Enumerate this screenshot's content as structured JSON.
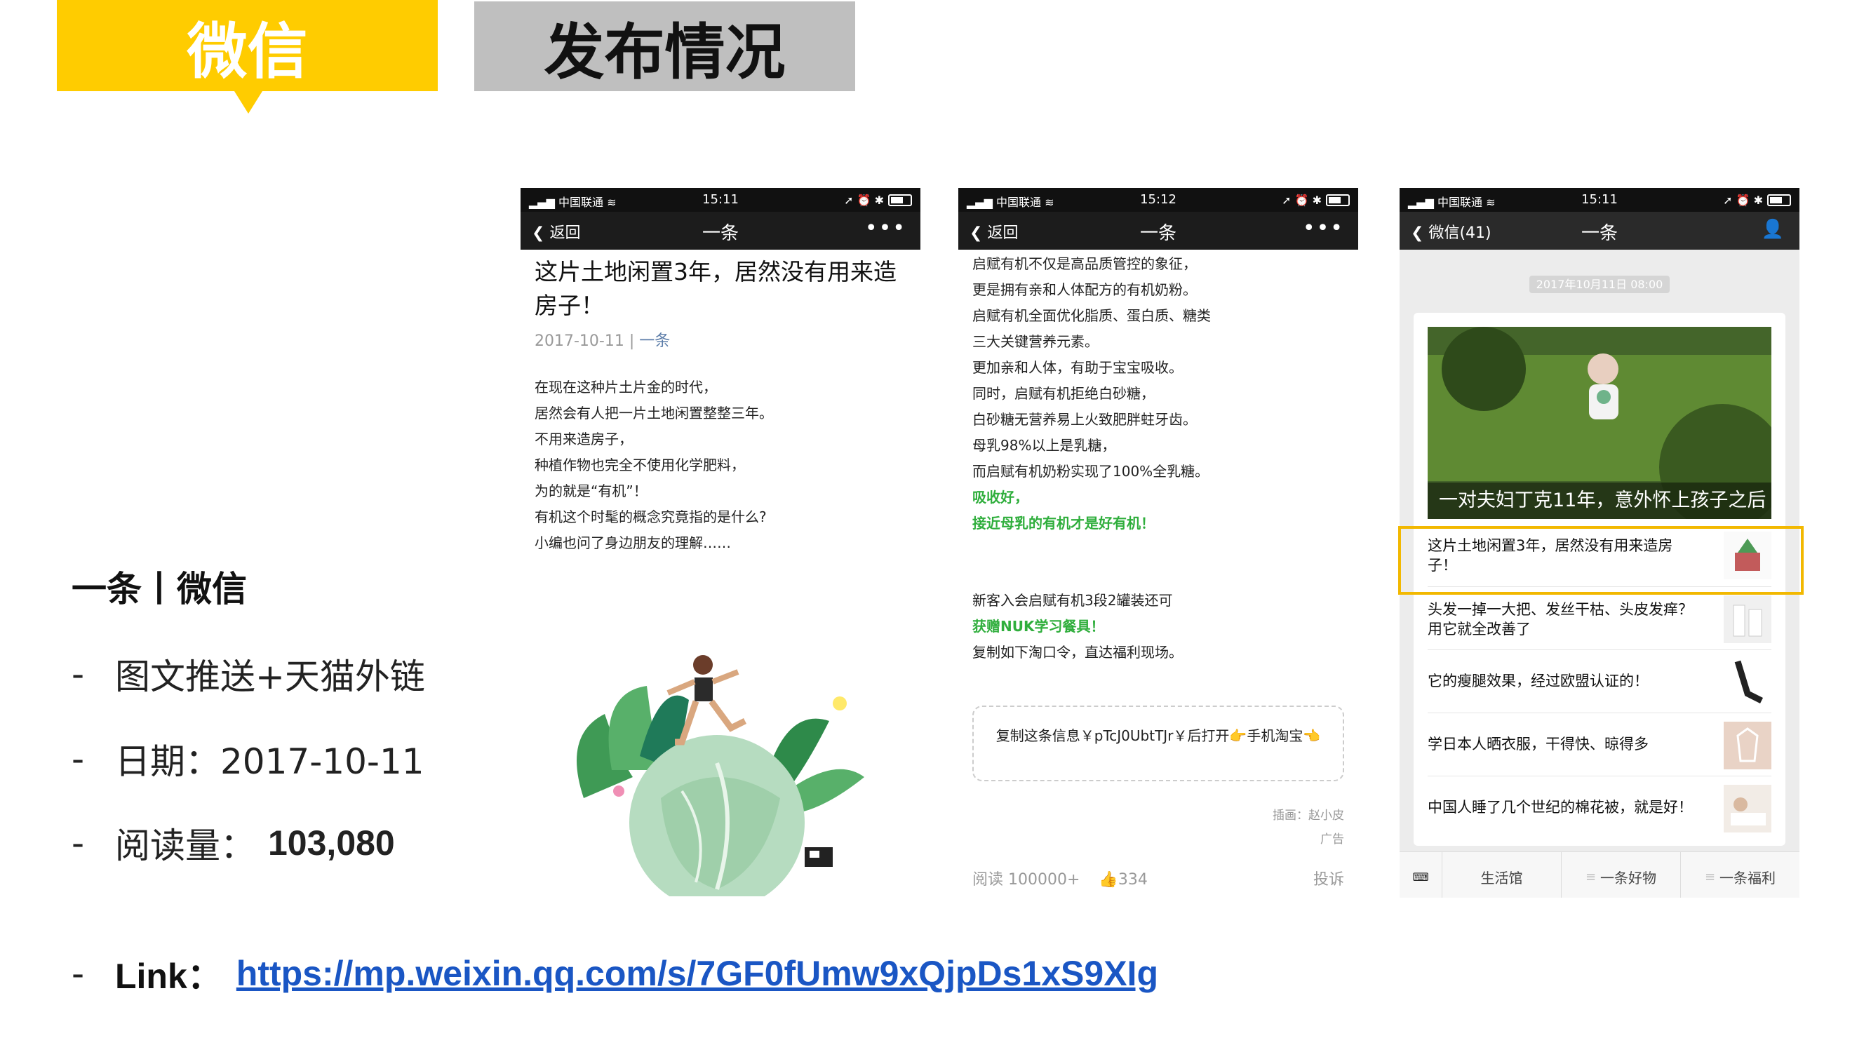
{
  "header": {
    "tag_primary": "微信",
    "tag_secondary": "发布情况"
  },
  "info": {
    "title": "一条丨微信",
    "items": [
      {
        "label": "图文推送+天猫外链",
        "value": ""
      },
      {
        "label": "日期：2017-10-11",
        "value": ""
      },
      {
        "label": "阅读量：",
        "value": "103,080"
      }
    ],
    "link_label": "Link：",
    "link_url": "https://mp.weixin.qq.com/s/7GF0fUmw9xQjpDs1xS9XIg"
  },
  "phone1": {
    "carrier": "中国联通",
    "time": "15:11",
    "back": "返回",
    "nav_title": "一条",
    "article_title": "这片土地闲置3年，居然没有用来造房子！",
    "date": "2017-10-11",
    "source": "一条",
    "lines": [
      "在现在这种片土片金的时代，",
      "居然会有人把一片土地闲置整整三年。",
      "不用来造房子，",
      "种植作物也完全不使用化学肥料，",
      "为的就是“有机”！",
      "有机这个时髦的概念究竟指的是什么?",
      "小编也问了身边朋友的理解……"
    ]
  },
  "phone2": {
    "carrier": "中国联通",
    "time": "15:12",
    "back": "返回",
    "nav_title": "一条",
    "lines": [
      "启赋有机不仅是高品质管控的象征，",
      "更是拥有亲和人体配方的有机奶粉。",
      "启赋有机全面优化脂质、蛋白质、糖类",
      "三大关键营养元素。",
      "更加亲和人体，有助于宝宝吸收。",
      "同时，启赋有机拒绝白砂糖，",
      "白砂糖无营养易上火致肥胖蛀牙齿。",
      "母乳98%以上是乳糖，",
      "而启赋有机奶粉实现了100%全乳糖。"
    ],
    "green1": "吸收好，",
    "green2": "接近母乳的有机才是好有机！",
    "promo": "新客入会启赋有机3段2罐装还可",
    "promo_green": "获赠NUK学习餐具！",
    "promo2": "复制如下淘口令，直达福利现场。",
    "coupon": "复制这条信息￥pTcJ0UbtTJr￥后打开👉手机淘宝👈",
    "illustrator": "插画：赵小皮",
    "ad": "广告",
    "reads": "阅读 100000+",
    "likes": "334",
    "report": "投诉"
  },
  "phone3": {
    "carrier": "中国联通",
    "time": "15:11",
    "back": "微信(41)",
    "nav_title": "一条",
    "date_pill": "2017年10月11日 08:00",
    "hero_caption": "一对夫妇丁克11年，意外怀上孩子之后",
    "items": [
      {
        "title": "这片土地闲置3年，居然没有用来造房子！"
      },
      {
        "title": "头发一掉一大把、发丝干枯、头皮发痒？用它就全改善了"
      },
      {
        "title": "它的瘦腿效果，经过欧盟认证的！"
      },
      {
        "title": "学日本人晒衣服，干得快、晾得多"
      },
      {
        "title": "中国人睡了几个世纪的棉花被，就是好！"
      }
    ],
    "tabs": [
      "生活馆",
      "一条好物",
      "一条福利"
    ]
  },
  "colors": {
    "accent_yellow": "#ffcc00",
    "tag_gray": "#bfbfbf",
    "link_blue": "#1a56c4",
    "green_text": "#2fae3c",
    "highlight": "#f2b800"
  }
}
